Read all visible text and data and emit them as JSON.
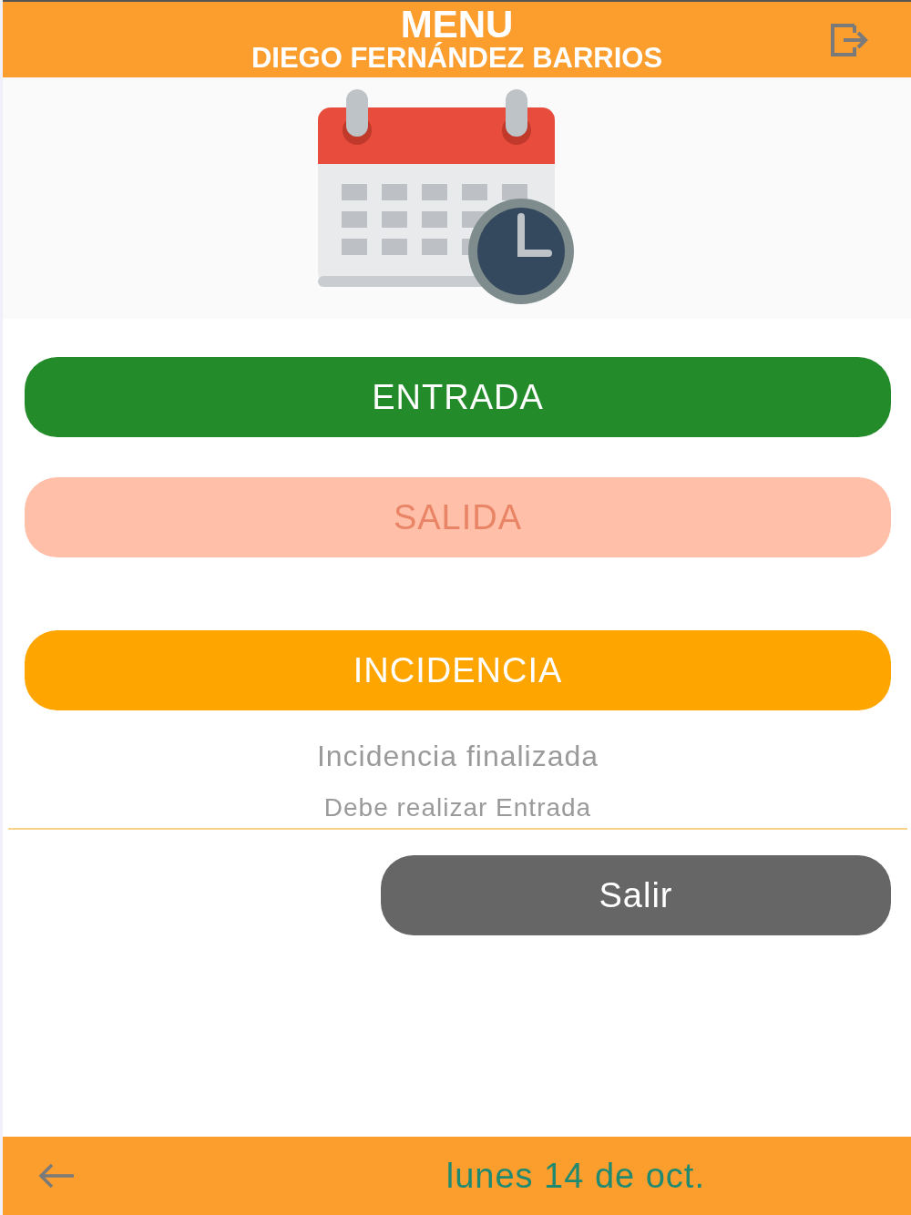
{
  "header": {
    "title": "MENU",
    "subtitle": "DIEGO FERNÁNDEZ BARRIOS"
  },
  "actions": [
    {
      "label": "ENTRADA",
      "kind": "entrada",
      "disabled": false
    },
    {
      "label": "SALIDA",
      "kind": "salida",
      "disabled": true
    },
    {
      "label": "INCIDENCIA",
      "kind": "incidencia",
      "disabled": false
    }
  ],
  "messages": [
    "Incidencia finalizada",
    "Debe realizar Entrada"
  ],
  "exit_button": {
    "label": "Salir"
  },
  "footer": {
    "date": "lunes 14 de oct."
  }
}
